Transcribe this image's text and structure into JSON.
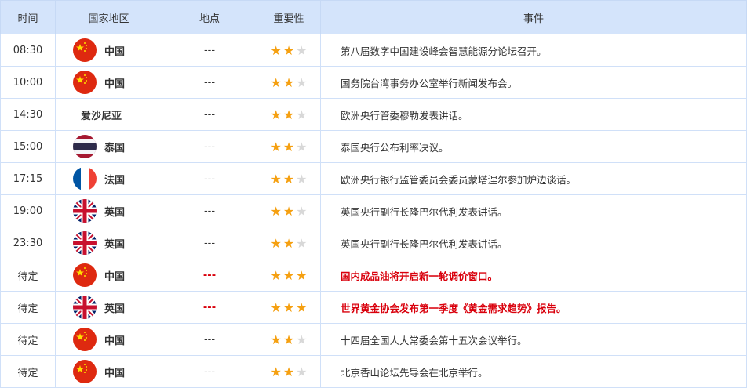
{
  "headers": [
    "时间",
    "国家地区",
    "地点",
    "重要性",
    "事件"
  ],
  "colors": {
    "header_bg": "#d4e4fb",
    "star_on": "#f5a011",
    "star_off": "#d8d8d8",
    "highlight": "#d9000c"
  },
  "rows": [
    {
      "time": "08:30",
      "flag": "cn",
      "country": "中国",
      "location": "---",
      "stars": 2,
      "event": "第八届数字中国建设峰会智慧能源分论坛召开。",
      "highlight": false
    },
    {
      "time": "10:00",
      "flag": "cn",
      "country": "中国",
      "location": "---",
      "stars": 2,
      "event": "国务院台湾事务办公室举行新闻发布会。",
      "highlight": false
    },
    {
      "time": "14:30",
      "flag": "",
      "country": "爱沙尼亚",
      "location": "---",
      "stars": 2,
      "event": "欧洲央行管委穆勒发表讲话。",
      "highlight": false
    },
    {
      "time": "15:00",
      "flag": "th",
      "country": "泰国",
      "location": "---",
      "stars": 2,
      "event": "泰国央行公布利率决议。",
      "highlight": false
    },
    {
      "time": "17:15",
      "flag": "fr",
      "country": "法国",
      "location": "---",
      "stars": 2,
      "event": "欧洲央行银行监管委员会委员蒙塔涅尔参加炉边谈话。",
      "highlight": false
    },
    {
      "time": "19:00",
      "flag": "uk",
      "country": "英国",
      "location": "---",
      "stars": 2,
      "event": "英国央行副行长隆巴尔代利发表讲话。",
      "highlight": false
    },
    {
      "time": "23:30",
      "flag": "uk",
      "country": "英国",
      "location": "---",
      "stars": 2,
      "event": "英国央行副行长隆巴尔代利发表讲话。",
      "highlight": false
    },
    {
      "time": "待定",
      "flag": "cn",
      "country": "中国",
      "location": "---",
      "stars": 3,
      "event": "国内成品油将开启新一轮调价窗口。",
      "highlight": true
    },
    {
      "time": "待定",
      "flag": "uk",
      "country": "英国",
      "location": "---",
      "stars": 3,
      "event": "世界黄金协会发布第一季度《黄金需求趋势》报告。",
      "highlight": true
    },
    {
      "time": "待定",
      "flag": "cn",
      "country": "中国",
      "location": "---",
      "stars": 2,
      "event": "十四届全国人大常委会第十五次会议举行。",
      "highlight": false
    },
    {
      "time": "待定",
      "flag": "cn",
      "country": "中国",
      "location": "---",
      "stars": 2,
      "event": "北京香山论坛先导会在北京举行。",
      "highlight": false
    }
  ]
}
